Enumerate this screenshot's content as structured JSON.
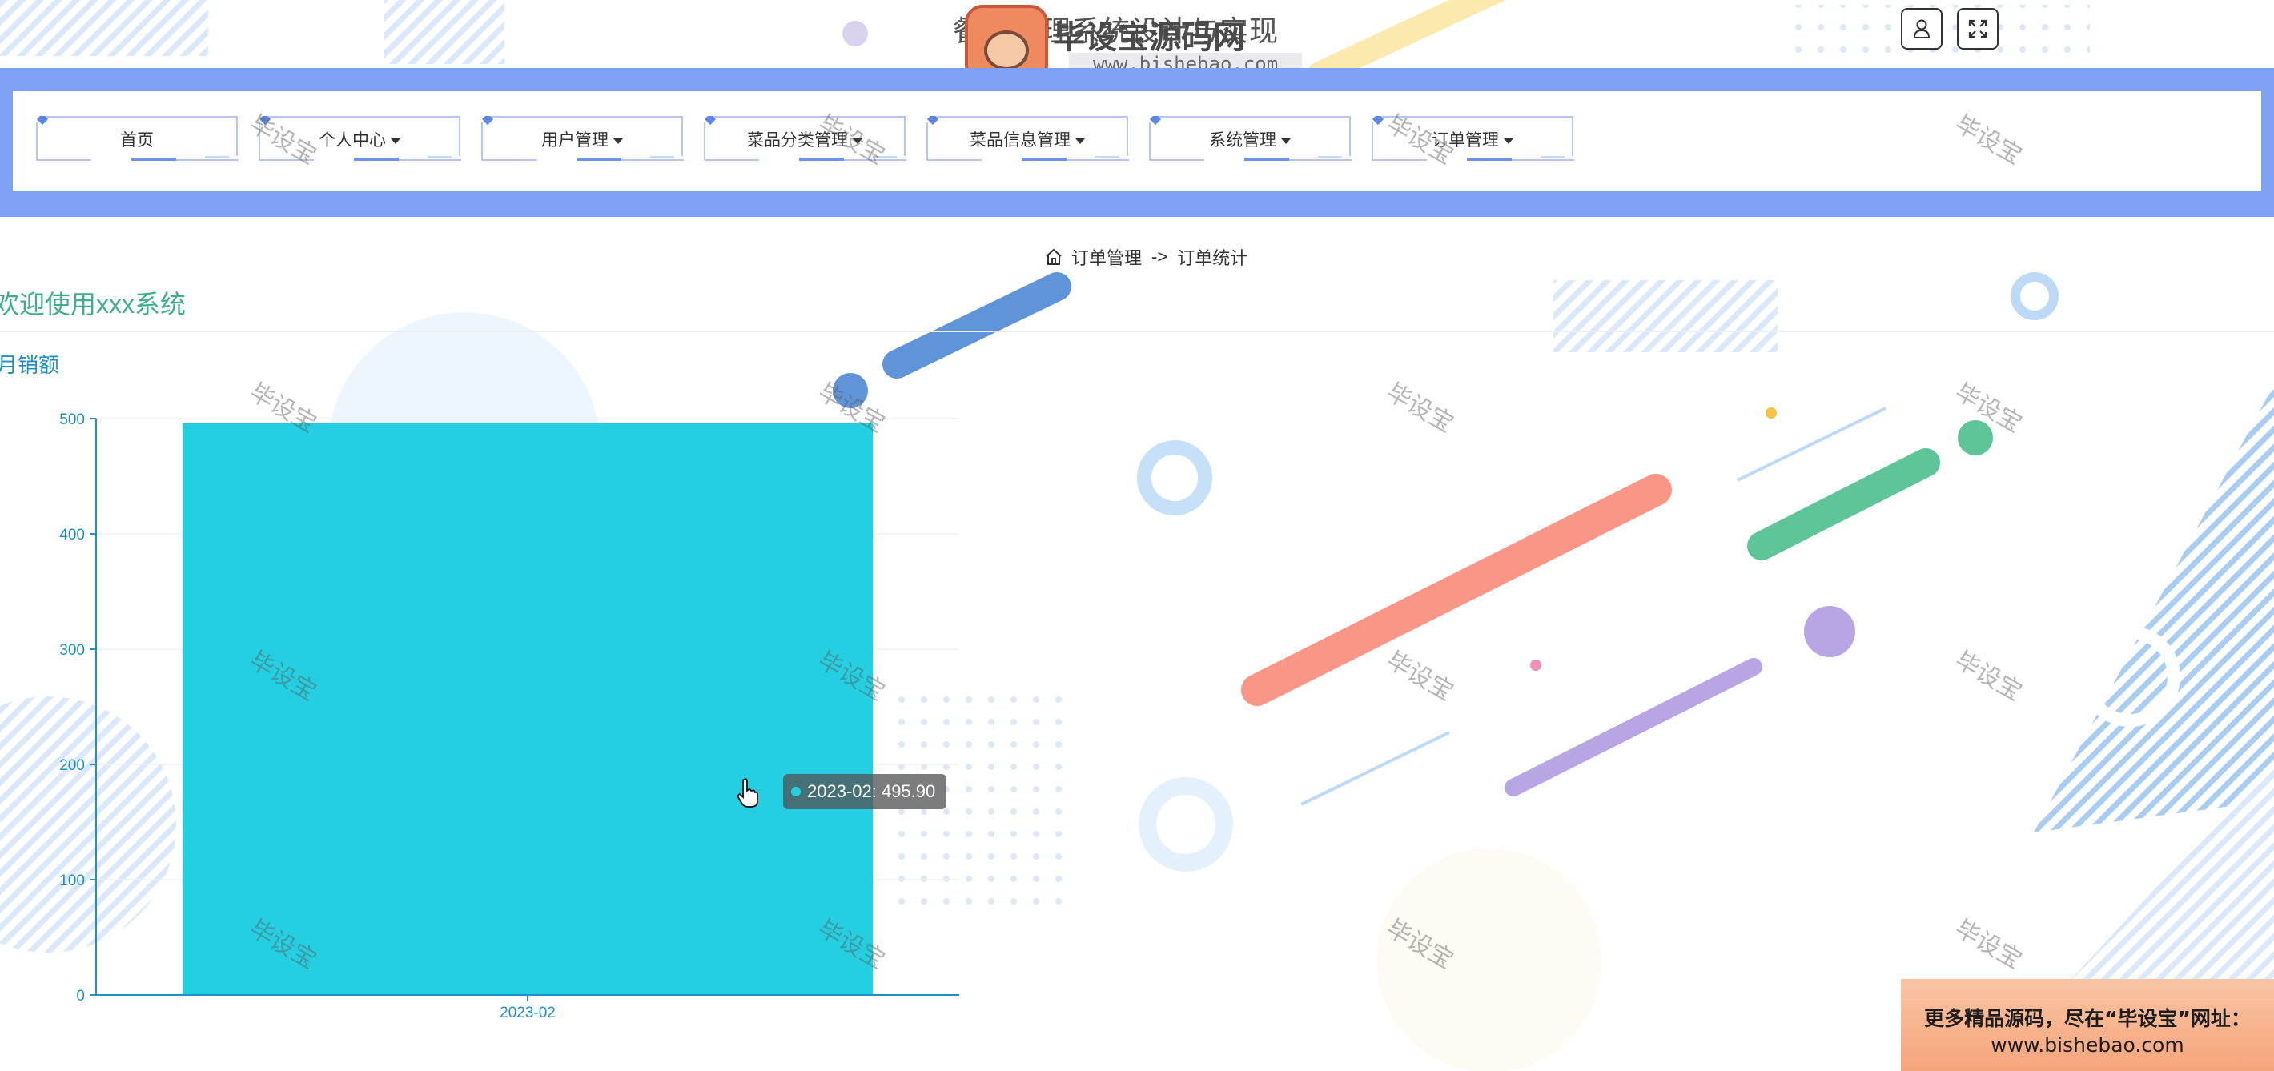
{
  "header": {
    "title": "餐饮管理系统设计与实现",
    "watermark_logo_text": "毕设宝源码网",
    "watermark_logo_url": "www.bishebao.com"
  },
  "nav": {
    "items": [
      {
        "label": "首页",
        "dropdown": false
      },
      {
        "label": "个人中心",
        "dropdown": true
      },
      {
        "label": "用户管理",
        "dropdown": true
      },
      {
        "label": "菜品分类管理",
        "dropdown": true
      },
      {
        "label": "菜品信息管理",
        "dropdown": true
      },
      {
        "label": "系统管理",
        "dropdown": true
      },
      {
        "label": "订单管理",
        "dropdown": true
      }
    ]
  },
  "top_icons": [
    "user-icon",
    "fullscreen-icon"
  ],
  "breadcrumb": {
    "home_icon": "home-icon",
    "parent": "订单管理",
    "separator": "->",
    "current": "订单统计"
  },
  "welcome": "欢迎使用xxx系统",
  "chart_data": {
    "type": "bar",
    "title": "月销额",
    "categories": [
      "2023-02"
    ],
    "values": [
      495.9
    ],
    "ylim": [
      0,
      500
    ],
    "yticks": [
      0,
      100,
      200,
      300,
      400,
      500
    ],
    "xlabel": "",
    "ylabel": "",
    "bar_color": "#24cfe2",
    "axis_color": "#1f8fc4",
    "tooltip": "2023-02: 495.90"
  },
  "watermark_text": "毕设宝",
  "ad": {
    "line1": "更多精品源码，尽在“毕设宝”网址：",
    "line2": "www.bishebao.com"
  },
  "colors": {
    "nav_band": "#7ea0f5",
    "welcome": "#3db08a",
    "accent_blue": "#1f8fc4"
  }
}
